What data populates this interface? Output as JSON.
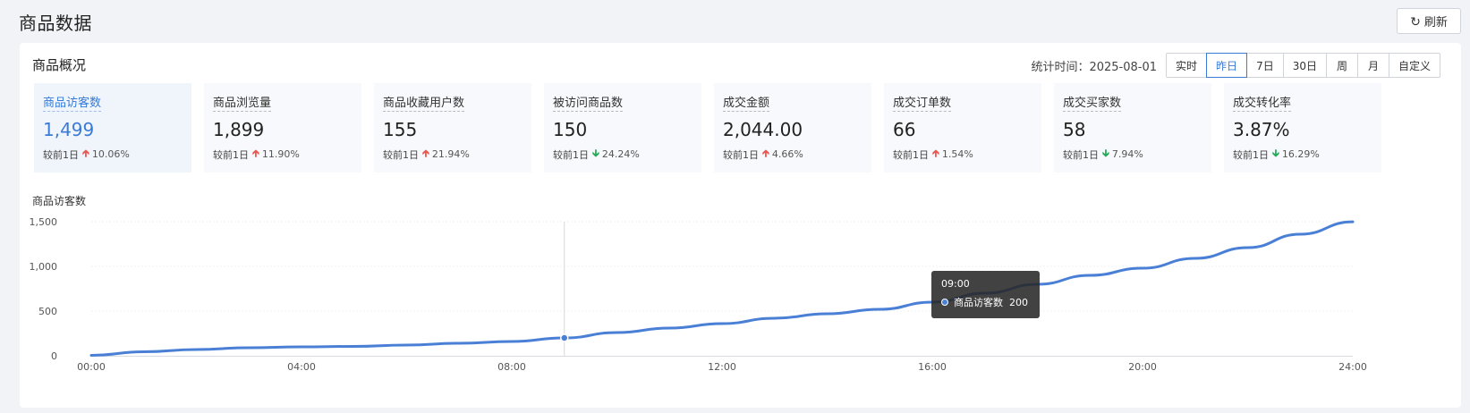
{
  "page": {
    "title": "商品数据"
  },
  "refresh": {
    "label": "刷新",
    "icon": "refresh-icon"
  },
  "overview": {
    "title": "商品概况",
    "period_label": "统计时间：2025-08-01",
    "periods": [
      "实时",
      "昨日",
      "7日",
      "30日",
      "周",
      "月",
      "自定义"
    ],
    "active_period": "昨日"
  },
  "metrics": [
    {
      "label": "商品访客数",
      "value": "1,499",
      "compare": "较前1日",
      "direction": "up",
      "change": "10.06%"
    },
    {
      "label": "商品浏览量",
      "value": "1,899",
      "compare": "较前1日",
      "direction": "up",
      "change": "11.90%"
    },
    {
      "label": "商品收藏用户数",
      "value": "155",
      "compare": "较前1日",
      "direction": "up",
      "change": "21.94%"
    },
    {
      "label": "被访问商品数",
      "value": "150",
      "compare": "较前1日",
      "direction": "down",
      "change": "24.24%"
    },
    {
      "label": "成交金额",
      "value": "2,044.00",
      "compare": "较前1日",
      "direction": "up",
      "change": "4.66%"
    },
    {
      "label": "成交订单数",
      "value": "66",
      "compare": "较前1日",
      "direction": "up",
      "change": "1.54%"
    },
    {
      "label": "成交买家数",
      "value": "58",
      "compare": "较前1日",
      "direction": "down",
      "change": "7.94%"
    },
    {
      "label": "成交转化率",
      "value": "3.87%",
      "compare": "较前1日",
      "direction": "down",
      "change": "16.29%"
    }
  ],
  "colors": {
    "accent": "#3a7bd5",
    "line": "#4a7fd6",
    "up": "#e8564f",
    "down": "#27a95a"
  },
  "chart_data": {
    "type": "line",
    "title": "商品访客数",
    "x_ticks": [
      "00:00",
      "04:00",
      "08:00",
      "12:00",
      "16:00",
      "20:00",
      "24:00"
    ],
    "y_ticks": [
      "0",
      "500",
      "1,000",
      "1,500"
    ],
    "ylim": [
      0,
      1500
    ],
    "xlim": [
      0,
      24
    ],
    "grid": true,
    "series": [
      {
        "name": "商品访客数",
        "x": [
          0,
          1,
          2,
          3,
          4,
          5,
          6,
          7,
          8,
          9,
          10,
          11,
          12,
          13,
          14,
          15,
          16,
          17,
          18,
          19,
          20,
          21,
          22,
          23,
          24
        ],
        "y": [
          5,
          45,
          70,
          90,
          100,
          105,
          120,
          140,
          160,
          200,
          260,
          310,
          360,
          420,
          470,
          520,
          600,
          700,
          800,
          900,
          980,
          1090,
          1210,
          1360,
          1499
        ]
      }
    ],
    "tooltip": {
      "x_label": "09:00",
      "series_name": "商品访客数",
      "value": "200",
      "index": 9
    }
  }
}
